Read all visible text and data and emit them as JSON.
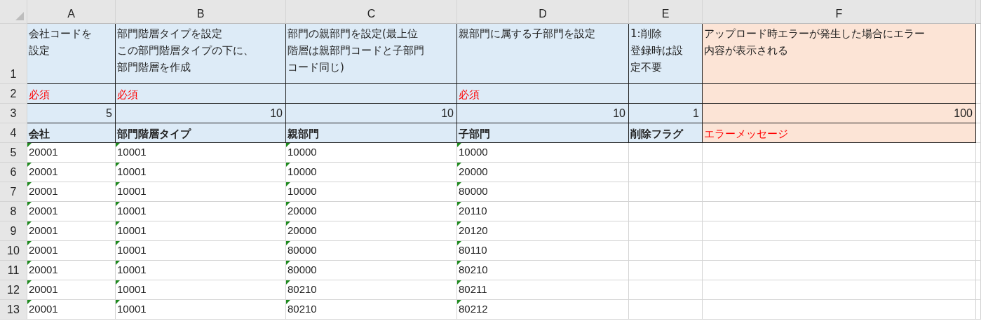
{
  "sheet": {
    "column_headers": [
      "A",
      "B",
      "C",
      "D",
      "E",
      "F"
    ],
    "header_rows": [
      "1",
      "2",
      "3",
      "4"
    ],
    "columns": [
      {
        "kind": "input",
        "description": [
          "会社コードを",
          "設定"
        ],
        "required": "必須",
        "length": "5",
        "field": "会社"
      },
      {
        "kind": "input",
        "description": [
          "部門階層タイプを設定",
          "この部門階層タイプの下に、",
          "部門階層を作成"
        ],
        "required": "必須",
        "length": "10",
        "field": "部門階層タイプ"
      },
      {
        "kind": "input",
        "description": [
          "部門の親部門を設定(最上位",
          "階層は親部門コードと子部門",
          "コード同じ)"
        ],
        "length": "10",
        "field": "親部門"
      },
      {
        "kind": "input",
        "description": [
          "親部門に属する子部門を設定"
        ],
        "required": "必須",
        "length": "10",
        "field": "子部門"
      },
      {
        "kind": "input",
        "description": [
          "1:削除",
          "登録時は設",
          "定不要"
        ],
        "length": "1",
        "field": "削除フラグ"
      },
      {
        "kind": "output",
        "description": [
          "アップロード時エラーが発生した場合にエラー",
          "内容が表示される"
        ],
        "length": "100",
        "field": "エラーメッセージ"
      }
    ],
    "rows": [
      {
        "number": "5",
        "cells": [
          "20001",
          "10001",
          "10000",
          "10000"
        ]
      },
      {
        "number": "6",
        "cells": [
          "20001",
          "10001",
          "10000",
          "20000"
        ]
      },
      {
        "number": "7",
        "cells": [
          "20001",
          "10001",
          "10000",
          "80000"
        ]
      },
      {
        "number": "8",
        "cells": [
          "20001",
          "10001",
          "20000",
          "20110"
        ]
      },
      {
        "number": "9",
        "cells": [
          "20001",
          "10001",
          "20000",
          "20120"
        ]
      },
      {
        "number": "10",
        "cells": [
          "20001",
          "10001",
          "80000",
          "80110"
        ]
      },
      {
        "number": "11",
        "cells": [
          "20001",
          "10001",
          "80000",
          "80210"
        ]
      },
      {
        "number": "12",
        "cells": [
          "20001",
          "10001",
          "80210",
          "80211"
        ]
      },
      {
        "number": "13",
        "cells": [
          "20001",
          "10001",
          "80210",
          "80212"
        ]
      }
    ]
  }
}
